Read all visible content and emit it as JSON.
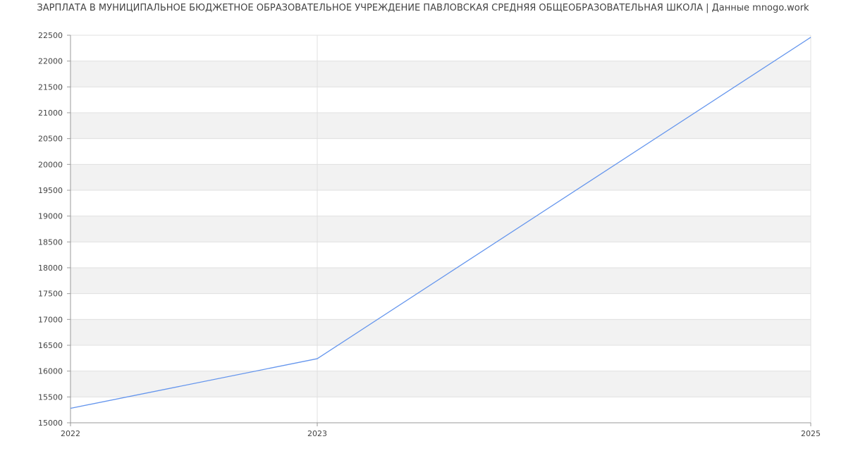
{
  "chart_data": {
    "type": "line",
    "title": "ЗАРПЛАТА В МУНИЦИПАЛЬНОЕ БЮДЖЕТНОЕ ОБРАЗОВАТЕЛЬНОЕ УЧРЕЖДЕНИЕ ПАВЛОВСКАЯ СРЕДНЯЯ ОБЩЕОБРАЗОВАТЕЛЬНАЯ ШКОЛА | Данные mnogo.work",
    "xlabel": "",
    "ylabel": "",
    "x": [
      "2022",
      "2023",
      "2025"
    ],
    "series": [
      {
        "values": [
          15280,
          16240,
          22460
        ]
      }
    ],
    "ylim": [
      15000,
      22500
    ],
    "yticks": [
      "15000",
      "15500",
      "16000",
      "16500",
      "17000",
      "17500",
      "18000",
      "18500",
      "19000",
      "19500",
      "20000",
      "20500",
      "21000",
      "21500",
      "22000",
      "22500"
    ],
    "xticks": [
      "2022",
      "2023",
      "2025"
    ],
    "grid": true,
    "line_color": "#6495ed",
    "band_color": "#f2f2f2",
    "grid_color": "#e0e0e0",
    "axis_color": "#999999"
  }
}
